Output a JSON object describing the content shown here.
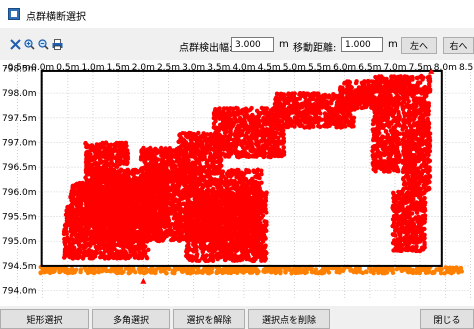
{
  "window": {
    "title": "点群横断選択"
  },
  "toolbar": {
    "detection_label": "点群検出幅:",
    "detection_value": "3.000",
    "detection_unit": "m",
    "move_label": "移動距離:",
    "move_value": "1.000",
    "move_unit": "m",
    "left_button": "左へ",
    "right_button": "右へ",
    "icons": [
      "fit-icon",
      "zoom-in-icon",
      "zoom-out-icon",
      "print-icon"
    ]
  },
  "chart_data": {
    "type": "scatter",
    "x_ticks": [
      "-0.5m",
      "0.0m",
      "0.5m",
      "1.0m",
      "1.5m",
      "2.0m",
      "2.5m",
      "3.0m",
      "3.5m",
      "4.0m",
      "4.5m",
      "5.0m",
      "5.5m",
      "6.0m",
      "6.5m",
      "7.0m",
      "7.5m",
      "8.0m",
      "8.5m"
    ],
    "x_tick_values": [
      -0.5,
      0,
      0.5,
      1,
      1.5,
      2,
      2.5,
      3,
      3.5,
      4,
      4.5,
      5,
      5.5,
      6,
      6.5,
      7,
      7.5,
      8,
      8.5
    ],
    "y_ticks": [
      "798.5m",
      "798.0m",
      "797.5m",
      "797.0m",
      "796.5m",
      "796.0m",
      "795.5m",
      "795.0m",
      "794.5m",
      "794.0m"
    ],
    "y_tick_values": [
      798.5,
      798,
      797.5,
      797,
      796.5,
      796,
      795.5,
      795,
      794.5,
      794
    ],
    "xlim": [
      -0.5,
      8.5
    ],
    "ylim": [
      793.85,
      798.55
    ],
    "grid": true,
    "selection_box": {
      "x": [
        -0.02,
        7.93
      ],
      "y": [
        794.5,
        798.45
      ]
    },
    "series": [
      {
        "color": "#ff0000",
        "blobs": [
          {
            "x": [
              0.42,
              2.1
            ],
            "y": [
              794.65,
              795.7
            ]
          },
          {
            "x": [
              0.55,
              2.5
            ],
            "y": [
              795.3,
              796.2
            ]
          },
          {
            "x": [
              0.95,
              4.35
            ],
            "y": [
              795.0,
              796.45
            ]
          },
          {
            "x": [
              0.85,
              1.7
            ],
            "y": [
              796.2,
              797.0
            ]
          },
          {
            "x": [
              1.95,
              2.85
            ],
            "y": [
              796.2,
              796.9
            ]
          },
          {
            "x": [
              2.7,
              3.55
            ],
            "y": [
              796.4,
              797.2
            ]
          },
          {
            "x": [
              2.85,
              4.45
            ],
            "y": [
              794.6,
              796.0
            ]
          },
          {
            "x": [
              3.4,
              4.8
            ],
            "y": [
              796.7,
              797.7
            ]
          },
          {
            "x": [
              4.6,
              6.2
            ],
            "y": [
              797.3,
              798.0
            ]
          },
          {
            "x": [
              5.9,
              7.1
            ],
            "y": [
              797.7,
              798.25
            ]
          },
          {
            "x": [
              6.55,
              7.7
            ],
            "y": [
              798.0,
              798.35
            ]
          },
          {
            "x": [
              6.55,
              7.1
            ],
            "y": [
              796.4,
              797.9
            ]
          },
          {
            "x": [
              7.15,
              7.7
            ],
            "y": [
              796.0,
              798.1
            ]
          },
          {
            "x": [
              6.95,
              7.6
            ],
            "y": [
              794.8,
              796.0
            ]
          }
        ]
      },
      {
        "color": "#ff8000",
        "blobs": [
          {
            "x": [
              -0.05,
              8.35
            ],
            "y": [
              794.35,
              794.48
            ]
          }
        ]
      }
    ],
    "markers": [
      {
        "x": 2.0,
        "y": 794.2,
        "color": "#ff0000"
      },
      {
        "x": 7.72,
        "y": 798.45,
        "color": "#ff0000"
      }
    ]
  },
  "bottom": {
    "rect_select": "矩形選択",
    "poly_select": "多角選択",
    "deselect": "選択を解除",
    "delete_selected": "選択点を削除",
    "close": "閉じる"
  }
}
